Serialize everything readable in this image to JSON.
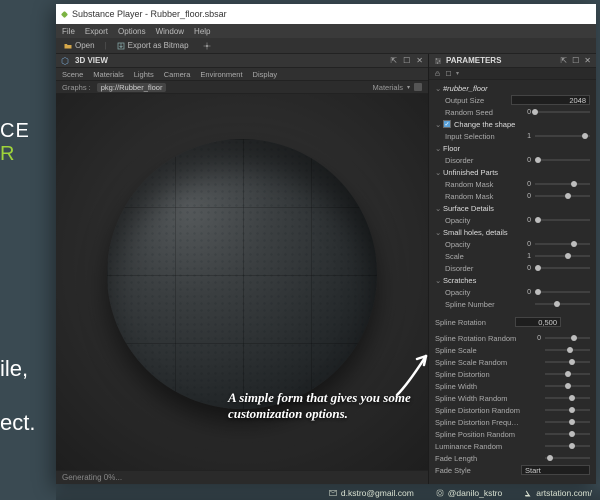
{
  "left_marketing": {
    "ce": "CE",
    "r": "R",
    "ile": "ile,",
    "ect": "ect."
  },
  "window": {
    "title": "Substance Player - Rubber_floor.sbsar"
  },
  "menubar": [
    "File",
    "Export",
    "Options",
    "Window",
    "Help"
  ],
  "toolbar": {
    "open": "Open",
    "export_bitmap": "Export as Bitmap"
  },
  "view3d": {
    "title": "3D VIEW",
    "tabs": [
      "Scene",
      "Materials",
      "Lights",
      "Camera",
      "Environment",
      "Display"
    ],
    "graph_label": "Graphs :",
    "graph_value": "pkg://Rubber_floor",
    "materials_label": "Materials",
    "status": "Generating 0%..."
  },
  "params": {
    "title": "PARAMETERS",
    "root": "#rubber_floor",
    "top": [
      {
        "label": "Output Size",
        "value": "2048",
        "kind": "input"
      },
      {
        "label": "Random Seed",
        "value": "0",
        "kind": "slider",
        "pos": 0.0
      }
    ],
    "groups": [
      {
        "name": "Change the shape",
        "checkbox": true,
        "rows": [
          {
            "label": "Input Selection",
            "value": "1",
            "kind": "slider",
            "pos": 0.9
          }
        ]
      },
      {
        "name": "Floor",
        "rows": [
          {
            "label": "Disorder",
            "value": "0",
            "kind": "slider",
            "pos": 0.05
          }
        ]
      },
      {
        "name": "Unfinished Parts",
        "rows": [
          {
            "label": "Random Mask",
            "value": "0",
            "kind": "slider",
            "pos": 0.7
          },
          {
            "label": "Random Mask",
            "value": "0",
            "kind": "slider",
            "pos": 0.6
          }
        ]
      },
      {
        "name": "Surface Details",
        "rows": [
          {
            "label": "Opacity",
            "value": "0",
            "kind": "slider",
            "pos": 0.05
          }
        ]
      },
      {
        "name": "Small holes, details",
        "rows": [
          {
            "label": "Opacity",
            "value": "0",
            "kind": "slider",
            "pos": 0.7
          },
          {
            "label": "Scale",
            "value": "1",
            "kind": "slider",
            "pos": 0.6
          },
          {
            "label": "Disorder",
            "value": "0",
            "kind": "slider",
            "pos": 0.05
          }
        ]
      },
      {
        "name": "Scratches",
        "rows": [
          {
            "label": "Opacity",
            "value": "0",
            "kind": "slider",
            "pos": 0.05
          },
          {
            "label": "Spline Number",
            "value": "",
            "kind": "slider",
            "pos": 0.4
          }
        ]
      }
    ],
    "spline_rotation": {
      "label": "Spline Rotation",
      "value": "0,500"
    },
    "spline_rows": [
      {
        "label": "Spline Rotation Random",
        "value": "0",
        "pos": 0.65
      },
      {
        "label": "Spline Scale",
        "value": "",
        "pos": 0.55
      },
      {
        "label": "Spline Scale Random",
        "value": "",
        "pos": 0.6
      },
      {
        "label": "Spline Distortion",
        "value": "",
        "pos": 0.5
      },
      {
        "label": "Spline Width",
        "value": "",
        "pos": 0.5
      },
      {
        "label": "Spline Width Random",
        "value": "",
        "pos": 0.6
      },
      {
        "label": "Spline Distortion Random",
        "value": "",
        "pos": 0.6
      },
      {
        "label": "Spline Distortion Frequency",
        "value": "",
        "pos": 0.6
      },
      {
        "label": "Spline Position Random",
        "value": "",
        "pos": 0.6
      },
      {
        "label": "Luminance Random",
        "value": "",
        "pos": 0.6
      },
      {
        "label": "Fade Length",
        "value": "",
        "pos": 0.1
      }
    ],
    "fade_style": {
      "label": "Fade Style",
      "value": "Start"
    }
  },
  "annotation": "A simple form that gives you some customization options.",
  "footer": {
    "email": "d.kstro@gmail.com",
    "insta": "@danilo_kstro",
    "artstation": "artstation.com/"
  }
}
